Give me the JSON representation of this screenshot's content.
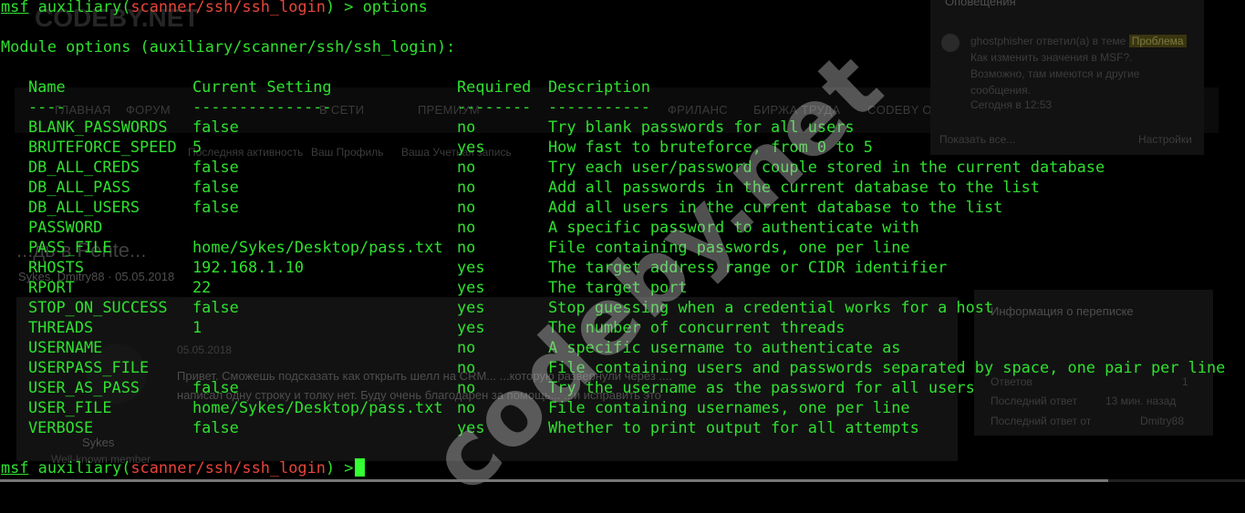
{
  "background_page": {
    "logo": "CODEBY.NET",
    "nav_items": [
      "ГЛАВНАЯ",
      "ФОРУМ",
      "В СЕТИ",
      "ПРЕМИУМ",
      "ФРИЛАНС",
      "БИРЖА ТРУДА",
      "CODEBY О"
    ],
    "subnav_items": [
      "Последняя активность",
      "Ваш Профиль",
      "Ваша Учетная запись"
    ],
    "thread_title": "...дь в Pente...",
    "thread_meta": "Sykes, Dmitry88 · 05.05.2018",
    "post_date": "05.05.2018",
    "post_text_1": "Привет. Сможешь подсказать как открыть шелл на CRM... ...которую развернули через ....",
    "post_text_2": "написал одну строку и толку нет. Буду очень благодарен за помощь... ...и исправить это",
    "author_name": "Sykes",
    "author_role": "Well-known member",
    "notifications": {
      "title": "Оповещения",
      "user": "ghostphisher",
      "action": "ответил(а) в теме",
      "badge": "Проблема",
      "message": "Как изменить значения в MSF?. Возможно, там имеются и другие сообщения.",
      "time": "Сегодня в 12:53",
      "show_all": "Показать все...",
      "settings": "Настройки"
    },
    "info": {
      "title": "Информация о переписке",
      "answers_label": "Ответов",
      "answers_value": "1",
      "last_reply_label": "Последний ответ",
      "last_reply_value": "13 мин. назад",
      "last_from_label": "Последний ответ от",
      "last_from_value": "Dmitry88"
    },
    "watermark": "codeby.net"
  },
  "terminal": {
    "prompt_prefix": "msf",
    "prompt_open": " auxiliary(",
    "module": "scanner/ssh/ssh_login",
    "prompt_close": ") > ",
    "command": "options",
    "section_title": "Module options (auxiliary/scanner/ssh/ssh_login):",
    "headers": [
      "Name",
      "Current Setting",
      "Required",
      "Description"
    ],
    "underlines": [
      "----",
      "---------------",
      "--------",
      "-----------"
    ],
    "rows": [
      [
        "BLANK_PASSWORDS",
        "false",
        "no",
        "Try blank passwords for all users"
      ],
      [
        "BRUTEFORCE_SPEED",
        "5",
        "yes",
        "How fast to bruteforce, from 0 to 5"
      ],
      [
        "DB_ALL_CREDS",
        "false",
        "no",
        "Try each user/password couple stored in the current database"
      ],
      [
        "DB_ALL_PASS",
        "false",
        "no",
        "Add all passwords in the current database to the list"
      ],
      [
        "DB_ALL_USERS",
        "false",
        "no",
        "Add all users in the current database to the list"
      ],
      [
        "PASSWORD",
        "",
        "no",
        "A specific password to authenticate with"
      ],
      [
        "PASS_FILE",
        "home/Sykes/Desktop/pass.txt",
        "no",
        "File containing passwords, one per line"
      ],
      [
        "RHOSTS",
        "192.168.1.10",
        "yes",
        "The target address range or CIDR identifier"
      ],
      [
        "RPORT",
        "22",
        "yes",
        "The target port"
      ],
      [
        "STOP_ON_SUCCESS",
        "false",
        "yes",
        "Stop guessing when a credential works for a host"
      ],
      [
        "THREADS",
        "1",
        "yes",
        "The number of concurrent threads"
      ],
      [
        "USERNAME",
        "",
        "no",
        "A specific username to authenticate as"
      ],
      [
        "USERPASS_FILE",
        "",
        "no",
        "File containing users and passwords separated by space, one pair per line"
      ],
      [
        "USER_AS_PASS",
        "false",
        "no",
        "Try the username as the password for all users"
      ],
      [
        "USER_FILE",
        "home/Sykes/Desktop/pass.txt",
        "no",
        "File containing usernames, one per line"
      ],
      [
        "VERBOSE",
        "false",
        "yes",
        "Whether to print output for all attempts"
      ]
    ]
  },
  "colors": {
    "terminal_green": "#2fe02f",
    "module_red": "#e8453a",
    "background": "#000000"
  }
}
